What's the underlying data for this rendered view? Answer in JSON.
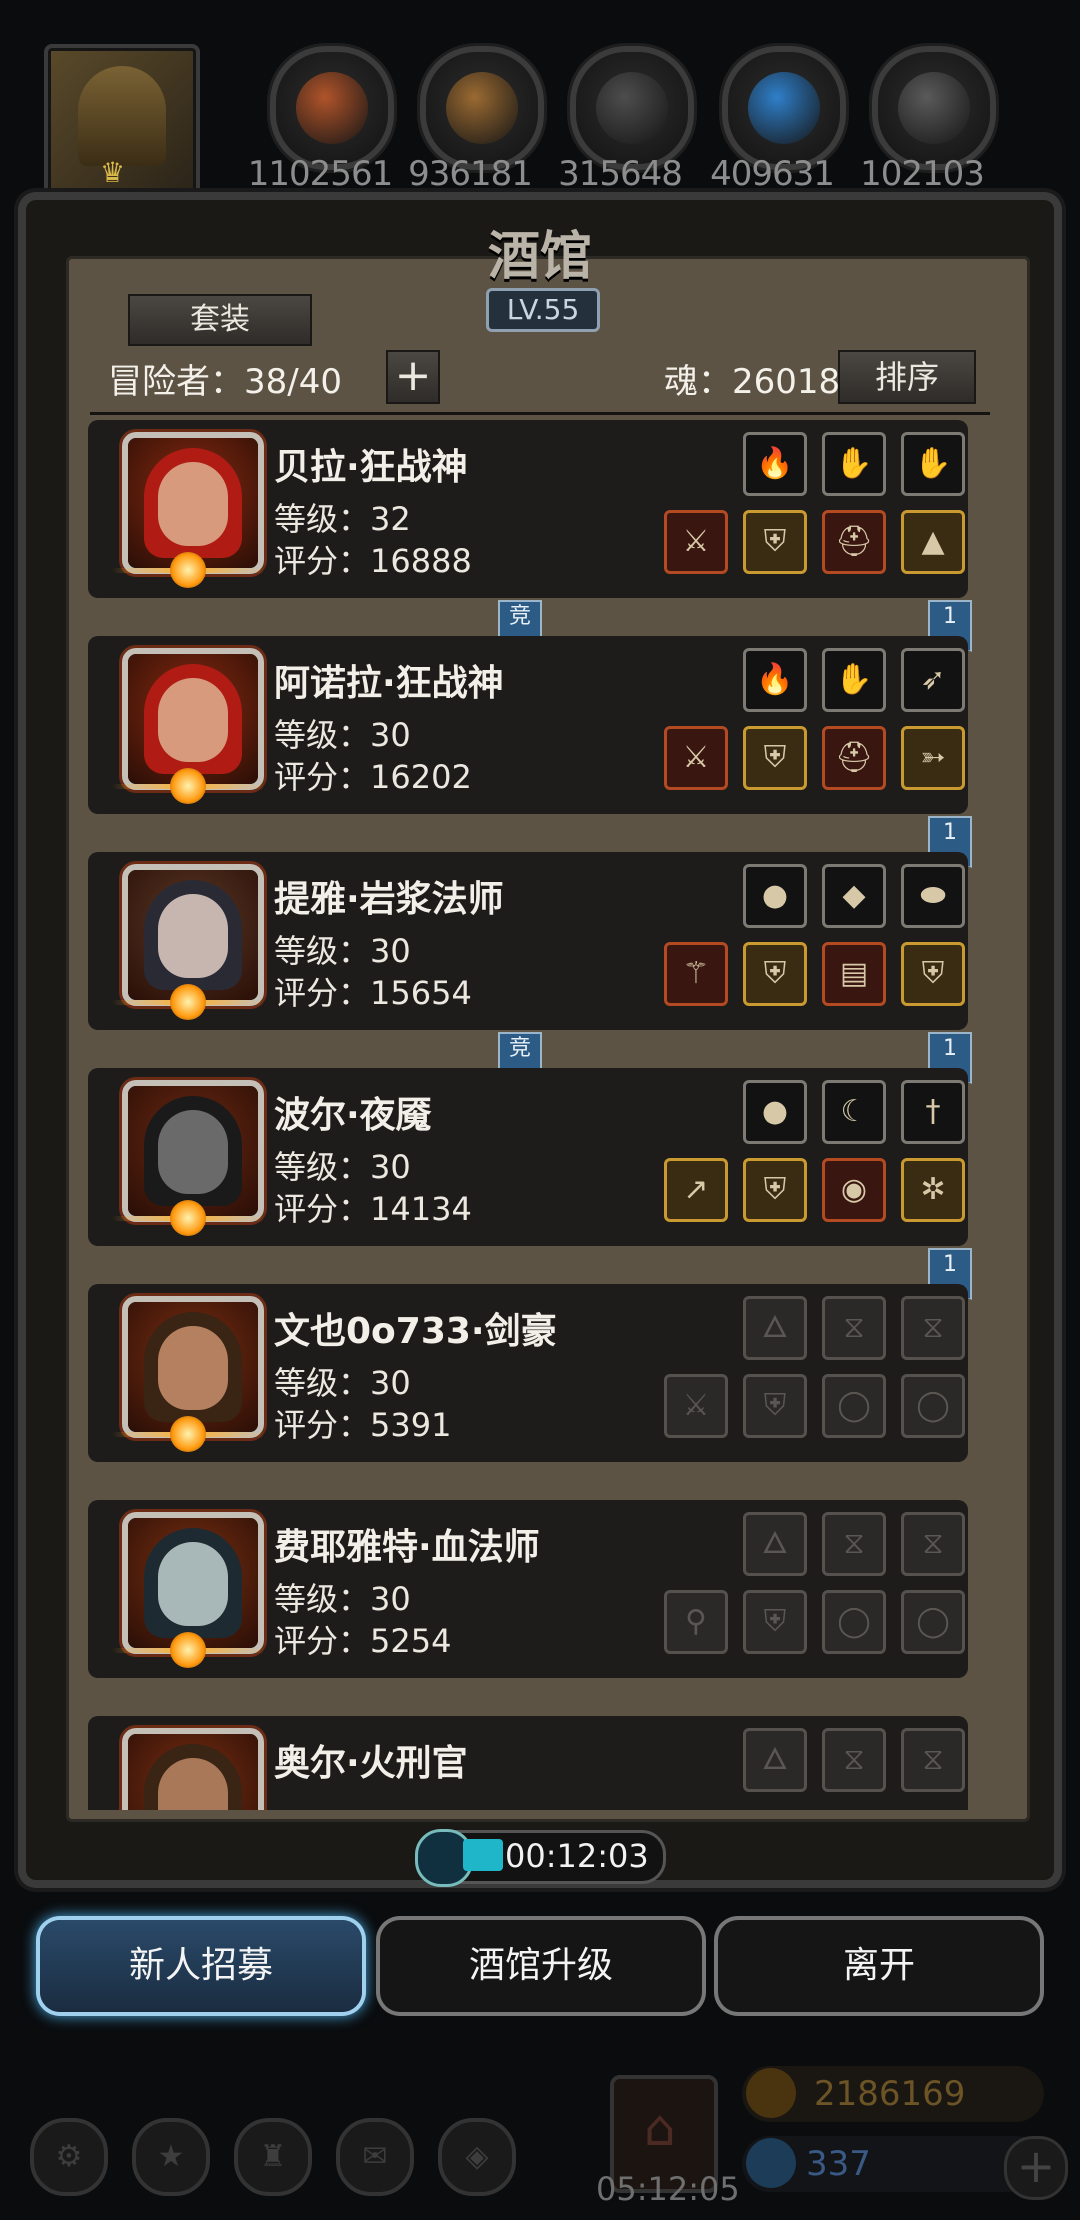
{
  "resources": [
    {
      "name": "meat-icon",
      "value": "1102561",
      "color": "#b0542a"
    },
    {
      "name": "wood-icon",
      "value": "936181",
      "color": "#9a6a32"
    },
    {
      "name": "iron-icon",
      "value": "315648",
      "color": "#4d4d4d"
    },
    {
      "name": "crystal-icon",
      "value": "409631",
      "color": "#2f7fc9"
    },
    {
      "name": "ore-icon",
      "value": "102103",
      "color": "#5a5a5a"
    }
  ],
  "panel": {
    "title": "酒馆",
    "level": "LV.55",
    "set_button": "套装",
    "adventurers": "冒险者：38/40",
    "add_symbol": "+",
    "soul": "魂：26018",
    "sort_button": "排序"
  },
  "heroes": [
    {
      "name": "贝拉·狂战神",
      "level": "等级：32",
      "score": "评分：16888",
      "hair": "#b01c14",
      "skin": "#d79a7c",
      "bg": "#8a2a10",
      "top_slots": [
        "fire",
        "gauntlet",
        "gauntlet"
      ],
      "bottom_slots": [
        "axe",
        "armor",
        "helm",
        "boots"
      ],
      "tag_left": "竞",
      "tag_right": "1"
    },
    {
      "name": "阿诺拉·狂战神",
      "level": "等级：30",
      "score": "评分：16202",
      "hair": "#b01c14",
      "skin": "#d79a7c",
      "bg": "#8a2a10",
      "top_slots": [
        "fire",
        "gauntlet",
        "feather"
      ],
      "bottom_slots": [
        "axe",
        "armor",
        "helm",
        "bow"
      ],
      "tag_left": "",
      "tag_right": "1"
    },
    {
      "name": "提雅·岩浆法师",
      "level": "等级：30",
      "score": "评分：15654",
      "hair": "#2a2a35",
      "skin": "#c7b6b0",
      "bg": "#5a3a28",
      "top_slots": [
        "orb",
        "gem",
        "stone"
      ],
      "bottom_slots": [
        "staff",
        "robe",
        "book",
        "armor"
      ],
      "tag_left": "竞",
      "tag_right": "1"
    },
    {
      "name": "波尔·夜魇",
      "level": "等级：30",
      "score": "评分：14134",
      "hair": "#1a1a1a",
      "skin": "#6a6a6a",
      "bg": "#6a2812",
      "top_slots": [
        "orb",
        "crescent",
        "dagger"
      ],
      "bottom_slots": [
        "spear",
        "armor",
        "amulet",
        "compass"
      ],
      "tag_left": "",
      "tag_right": "1"
    },
    {
      "name": "文也0o733·剑豪",
      "level": "等级：30",
      "score": "评分：5391",
      "hair": "#3a2414",
      "skin": "#b48060",
      "bg": "#7a2e12",
      "top_slots": [
        "empty-fire",
        "empty-x",
        "empty-x"
      ],
      "bottom_slots": [
        "empty-sword",
        "empty-armor",
        "empty-ring",
        "empty-ring"
      ],
      "tag_left": "",
      "tag_right": ""
    },
    {
      "name": "费耶雅特·血法师",
      "level": "等级：30",
      "score": "评分：5254",
      "hair": "#1e2a32",
      "skin": "#a8b8b8",
      "bg": "#7a3012",
      "top_slots": [
        "empty-fire",
        "empty-x",
        "empty-x"
      ],
      "bottom_slots": [
        "empty-staff",
        "empty-armor",
        "empty-ring",
        "empty-ring"
      ],
      "tag_left": "",
      "tag_right": ""
    },
    {
      "name": "奥尔·火刑官",
      "level": "",
      "score": "",
      "hair": "#3a2414",
      "skin": "#a87858",
      "bg": "#7a2e12",
      "top_slots": [
        "empty-fire",
        "empty-x",
        "empty-x"
      ],
      "bottom_slots": [],
      "tag_left": "",
      "tag_right": ""
    }
  ],
  "timer": "00:12:03",
  "buttons": {
    "recruit": "新人招募",
    "upgrade": "酒馆升级",
    "leave": "离开"
  },
  "footer": {
    "gift_timer": "05:12:05",
    "gold": "2186169",
    "gems": "337"
  }
}
